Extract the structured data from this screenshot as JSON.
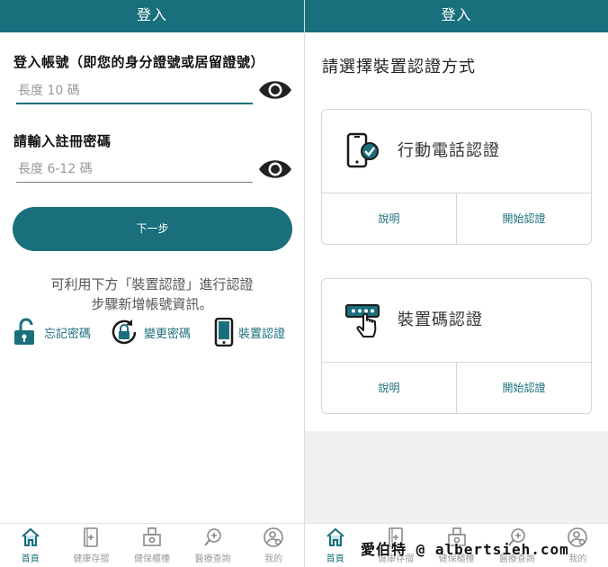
{
  "left": {
    "topbar_title": "登入",
    "account_label": "登入帳號（即您的身分證號或居留證號）",
    "account_placeholder": "長度 10 碼",
    "password_label": "請輸入註冊密碼",
    "password_placeholder": "長度 6-12 碼",
    "next_button": "下一步",
    "hint_line1": "可利用下方「裝置認證」進行認證",
    "hint_line2": "步驟新增帳號資訊。",
    "links": {
      "forgot": "忘記密碼",
      "change": "變更密碼",
      "device": "裝置認證"
    },
    "nav": [
      {
        "label": "首頁",
        "icon": "home-icon"
      },
      {
        "label": "健康存摺",
        "icon": "health-record-icon"
      },
      {
        "label": "健保櫃檯",
        "icon": "counter-icon"
      },
      {
        "label": "醫療查詢",
        "icon": "medical-search-icon"
      },
      {
        "label": "我的",
        "icon": "user-settings-icon"
      }
    ]
  },
  "right": {
    "topbar_title": "登入",
    "choose_title": "請選擇裝置認證方式",
    "methods": [
      {
        "name": "行動電話認證",
        "icon": "phone-verified-icon",
        "explain": "說明",
        "start": "開始認證"
      },
      {
        "name": "裝置碼認證",
        "icon": "device-code-icon",
        "explain": "說明",
        "start": "開始認證"
      }
    ],
    "nav": [
      {
        "label": "首頁",
        "icon": "home-icon"
      },
      {
        "label": "健康存摺",
        "icon": "health-record-icon"
      },
      {
        "label": "健保櫃檯",
        "icon": "counter-icon"
      },
      {
        "label": "醫療查詢",
        "icon": "medical-search-icon"
      },
      {
        "label": "我的",
        "icon": "user-settings-icon"
      }
    ]
  },
  "watermark": "愛伯特 @ albertsieh.com",
  "colors": {
    "primary": "#1a6f7d",
    "nav_inactive": "#9a9a9a",
    "grey_area": "#f0f0f0"
  }
}
